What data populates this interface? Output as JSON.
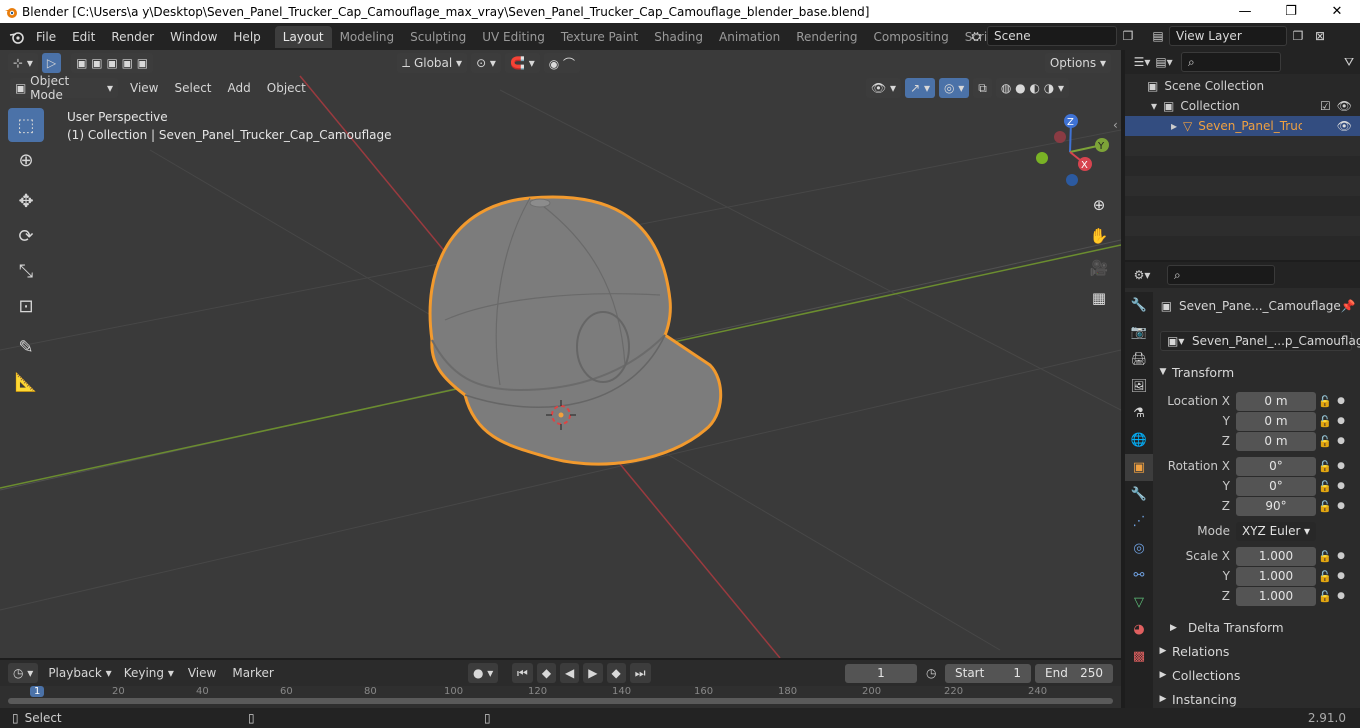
{
  "window": {
    "title": "Blender [C:\\Users\\a y\\Desktop\\Seven_Panel_Trucker_Cap_Camouflage_max_vray\\Seven_Panel_Trucker_Cap_Camouflage_blender_base.blend]",
    "minimize": "—",
    "maximize": "❐",
    "close": "✕"
  },
  "menu": [
    "File",
    "Edit",
    "Render",
    "Window",
    "Help"
  ],
  "workspaces": [
    "Layout",
    "Modeling",
    "Sculpting",
    "UV Editing",
    "Texture Paint",
    "Shading",
    "Animation",
    "Rendering",
    "Compositing",
    "Scripting"
  ],
  "add_workspace": "+",
  "scene": {
    "label": "Scene"
  },
  "view_layer": {
    "label": "View Layer"
  },
  "viewport": {
    "transform_orientation": "Global",
    "options_label": "Options",
    "mode": "Object Mode",
    "header_menus": [
      "View",
      "Select",
      "Add",
      "Object"
    ],
    "overlay_line1": "User Perspective",
    "overlay_line2": "(1) Collection | Seven_Panel_Trucker_Cap_Camouflage",
    "gizmo": {
      "x": "X",
      "y": "Y",
      "z": "Z"
    }
  },
  "outliner": {
    "search_placeholder": "",
    "scene_collection": "Scene Collection",
    "collection": "Collection",
    "object": "Seven_Panel_Trucker"
  },
  "properties": {
    "object_name": "Seven_Pane..._Camouflage",
    "data_name": "Seven_Panel_...p_Camouflage",
    "transform_title": "Transform",
    "location_label": "Location X",
    "rotation_label": "Rotation X",
    "scale_label": "Scale X",
    "y_label": "Y",
    "z_label": "Z",
    "location": [
      "0 m",
      "0 m",
      "0 m"
    ],
    "rotation": [
      "0°",
      "0°",
      "90°"
    ],
    "mode_label": "Mode",
    "mode_value": "XYZ Euler",
    "scale": [
      "1.000",
      "1.000",
      "1.000"
    ],
    "delta_transform": "Delta Transform",
    "relations": "Relations",
    "collections": "Collections",
    "instancing": "Instancing"
  },
  "timeline": {
    "menus": [
      "Playback",
      "Keying",
      "View",
      "Marker"
    ],
    "current_frame": "1",
    "start_label": "Start",
    "start_value": "1",
    "end_label": "End",
    "end_value": "250",
    "ticks": [
      "1",
      "20",
      "40",
      "60",
      "80",
      "100",
      "120",
      "140",
      "160",
      "180",
      "200",
      "220",
      "240"
    ]
  },
  "status": {
    "left": "Select",
    "version": "2.91.0"
  },
  "colors": {
    "accent_blue": "#4b72a8",
    "selection_orange": "#f0a040",
    "axis_x": "#d6444f",
    "axis_y": "#7da338",
    "axis_z": "#3f72d4"
  }
}
